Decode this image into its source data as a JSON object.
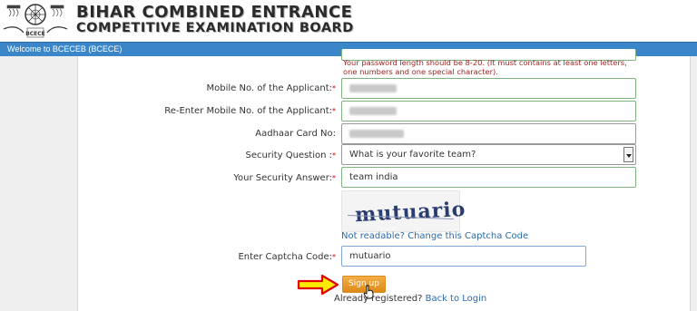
{
  "header": {
    "title_line1": "BIHAR COMBINED ENTRANCE",
    "title_line2": "COMPETITIVE EXAMINATION BOARD",
    "logo_icon": "bceceb-emblem-icon"
  },
  "welcome_bar": {
    "text": "Welcome to BCECEB (BCECE)"
  },
  "password_note": "Your password length should be 8-20. (It must contains at least one letters, one numbers and one special character).",
  "form": {
    "mobile": {
      "label": "Mobile No. of the Applicant:",
      "required": "*",
      "value": "redacted"
    },
    "remobile": {
      "label": "Re-Enter Mobile No. of the Applicant:",
      "required": "*",
      "value": "redacted"
    },
    "aadhaar": {
      "label": "Aadhaar Card No:",
      "value": "redacted"
    },
    "security_question": {
      "label": "Security Question :",
      "required": "*",
      "selected": "What is your favorite team?"
    },
    "security_answer": {
      "label": "Your Security Answer:",
      "required": "*",
      "value": "team india"
    },
    "captcha": {
      "image_text": "mutuario",
      "refresh_link": "Not readable? Change this Captcha Code",
      "label": "Enter Captcha Code:",
      "required": "*",
      "value": "mutuario"
    },
    "signup_button": "Sign up",
    "already_registered": "Already registered?",
    "back_to_login": "Back to Login"
  },
  "colors": {
    "header_bar": "#3a86c8",
    "button": "#e69522",
    "arrow_fill": "#ffeb00",
    "arrow_stroke": "#e00000"
  }
}
